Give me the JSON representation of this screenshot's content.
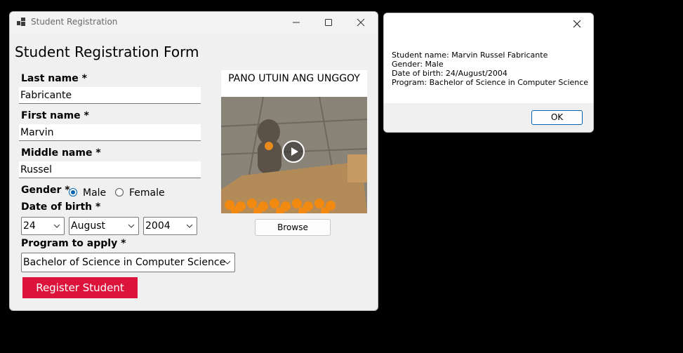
{
  "window": {
    "title": "Student Registration",
    "form_title": "Student Registration Form"
  },
  "fields": {
    "last_name_label": "Last name *",
    "last_name_value": "Fabricante",
    "first_name_label": "First name *",
    "first_name_value": "Marvin",
    "middle_name_label": "Middle name *",
    "middle_name_value": "Russel",
    "gender_label": "Gender *",
    "gender_options": [
      "Male",
      "Female"
    ],
    "gender_selected": "Male",
    "dob_label": "Date of birth *",
    "dob_day": "24",
    "dob_month": "August",
    "dob_year": "2004",
    "program_label": "Program to apply *",
    "program_value": "Bachelor of Science in Computer Science"
  },
  "buttons": {
    "register": "Register Student",
    "browse": "Browse"
  },
  "picture": {
    "caption": "PANO UTUIN ANG UNGGOY"
  },
  "dialog": {
    "lines": [
      "Student name: Marvin Russel Fabricante",
      "Gender: Male",
      "Date of birth: 24/August/2004",
      "Program: Bachelor of Science in Computer Science"
    ],
    "ok": "OK"
  },
  "colors": {
    "accent": "#dc143c",
    "radio": "#0063b1"
  },
  "icons": [
    "app-icon",
    "minimize-icon",
    "maximize-icon",
    "close-icon",
    "chevron-down-icon",
    "play-icon"
  ]
}
